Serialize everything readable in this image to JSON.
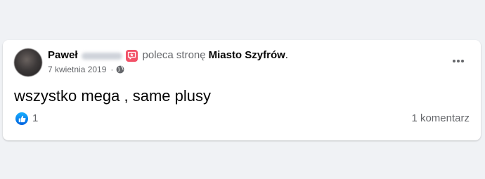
{
  "post": {
    "author": "Paweł",
    "action_text": "poleca stronę",
    "page_name": "Miasto Szyfrów",
    "punctuation": ".",
    "date": "7 kwietnia 2019",
    "separator": "·",
    "audience_icon": "globe-icon",
    "recommendation_icon": "star-recommend-icon",
    "body_text": "wszystko mega , same plusy",
    "reaction_icon": "thumbs-up-icon",
    "reaction_count": "1",
    "comments_label": "1 komentarz",
    "more_icon": "more-options-icon"
  },
  "colors": {
    "page_background": "#f0f2f5",
    "card_background": "#ffffff",
    "primary_text": "#050505",
    "secondary_text": "#65676b",
    "recommend_badge": "#f25268",
    "like_blue": "#1877f2"
  }
}
